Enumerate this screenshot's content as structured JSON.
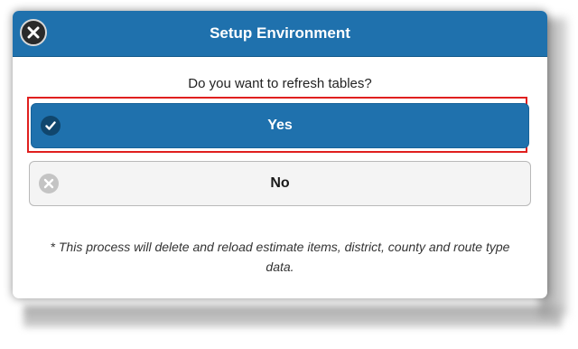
{
  "dialog": {
    "title": "Setup Environment",
    "question": "Do you want to refresh tables?",
    "yes_label": "Yes",
    "no_label": "No",
    "note": "* This process will delete and reload estimate items, district, county and route type data.",
    "icons": {
      "close": "close-icon",
      "yes": "check-icon",
      "no": "delete-icon"
    }
  },
  "colors": {
    "header": "#1f71ad",
    "yes_button": "#1f71ad",
    "no_button": "#f4f4f4",
    "highlight": "#e0201f"
  }
}
